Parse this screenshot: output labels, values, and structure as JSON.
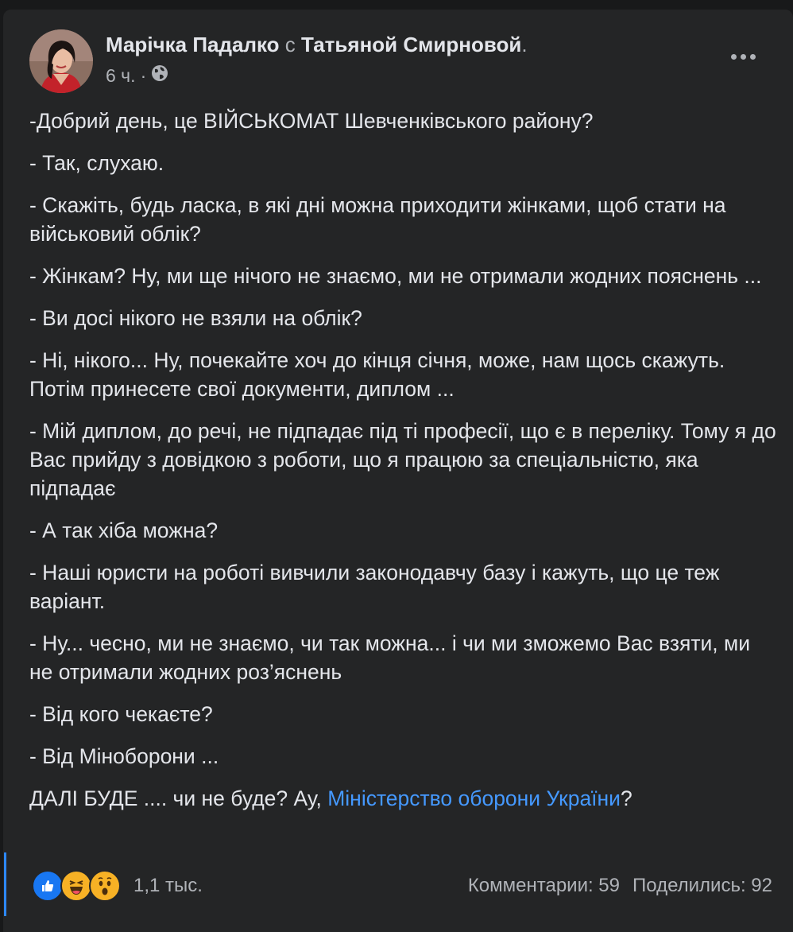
{
  "post": {
    "author": "Марічка Падалко",
    "with_word": "с",
    "tagged": "Татьяной Смирновой",
    "tagged_suffix": ".",
    "time": "6 ч.",
    "time_sep": "·",
    "privacy_icon": "globe-icon",
    "paragraphs": [
      "-Добрий день, це ВІЙСЬКОМАТ Шевченківського району?",
      "- Так, слухаю.",
      "- Скажіть, будь ласка, в які дні можна приходити жінками, щоб стати на військовий облік?",
      "- Жінкам? Ну, ми ще нічого не знаємо, ми не отримали жодних пояснень ...",
      "- Ви досі нікого не взяли на облік?",
      "- Ні, нікого... Ну, почекайте хоч до кінця січня, може, нам щось скажуть. Потім принесете свої документи, диплом ...",
      "- Мій диплом, до речі, не підпадає під ті професії, що є в переліку. Тому я до Вас прийду з довідкою з роботи, що я працюю за спеціальністю, яка підпадає",
      "- А так хіба можна?",
      "- Наші юристи на роботі вивчили законодавчу базу і кажуть, що це теж варіант.",
      "- Ну... чесно, ми не знаємо, чи так можна... і чи ми зможемо Вас взяти, ми не отримали жодних роз’яснень",
      "- Від кого чекаєте?",
      "- Від Міноборони ..."
    ],
    "final_prefix": "ДАЛІ БУДЕ .... чи не буде? Ау, ",
    "final_link": "Міністерство оборони України",
    "final_suffix": "?"
  },
  "footer": {
    "reactions": [
      "like-icon",
      "haha-icon",
      "wow-icon"
    ],
    "reaction_count": "1,1 тыс.",
    "comments": "Комментарии: 59",
    "shares": "Поделились: 92"
  },
  "colors": {
    "background": "#18191a",
    "card": "#242526",
    "text_primary": "#e4e6eb",
    "text_secondary": "#b0b3b8",
    "link": "#4599ff",
    "like_blue": "#1877f2",
    "emoji_yellow": "#f7b125"
  }
}
